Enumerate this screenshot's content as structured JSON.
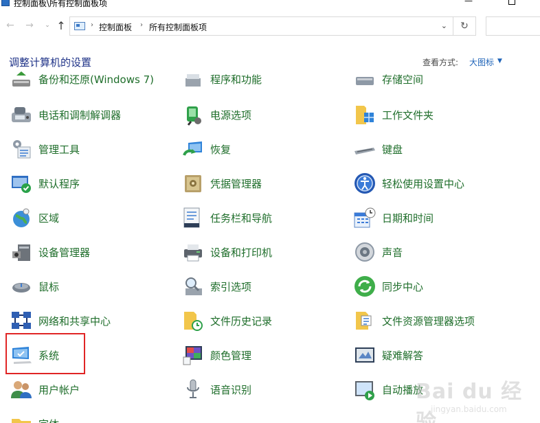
{
  "window": {
    "title": "控制面板\\所有控制面板项",
    "minimize": "—",
    "maximize": ""
  },
  "nav": {
    "back": "←",
    "forward": "→",
    "recent": "⌄",
    "up": "↑",
    "refresh": "↻",
    "breadcrumbs": [
      "控制面板",
      "所有控制面板项"
    ],
    "sep": "›",
    "dropdown": "⌄"
  },
  "header": {
    "title": "调整计算机的设置",
    "view_by_label": "查看方式:",
    "view_by_value": "大图标",
    "view_caret": "▼"
  },
  "items": {
    "col1": [
      {
        "label": "备份和还原(Windows 7)",
        "icon": "backup-icon"
      },
      {
        "label": "电话和调制解调器",
        "icon": "phone-modem-icon"
      },
      {
        "label": "管理工具",
        "icon": "admin-tools-icon"
      },
      {
        "label": "默认程序",
        "icon": "default-programs-icon"
      },
      {
        "label": "区域",
        "icon": "region-globe-icon"
      },
      {
        "label": "设备管理器",
        "icon": "device-manager-icon"
      },
      {
        "label": "鼠标",
        "icon": "mouse-icon"
      },
      {
        "label": "网络和共享中心",
        "icon": "network-icon"
      },
      {
        "label": "系统",
        "icon": "system-monitor-icon"
      },
      {
        "label": "用户帐户",
        "icon": "user-accounts-icon"
      },
      {
        "label": "字体",
        "icon": "fonts-folder-icon"
      }
    ],
    "col2": [
      {
        "label": "程序和功能",
        "icon": "programs-icon"
      },
      {
        "label": "电源选项",
        "icon": "power-options-icon"
      },
      {
        "label": "恢复",
        "icon": "recovery-icon"
      },
      {
        "label": "凭据管理器",
        "icon": "credential-vault-icon"
      },
      {
        "label": "任务栏和导航",
        "icon": "taskbar-icon"
      },
      {
        "label": "设备和打印机",
        "icon": "printer-icon"
      },
      {
        "label": "索引选项",
        "icon": "index-search-icon"
      },
      {
        "label": "文件历史记录",
        "icon": "file-history-icon"
      },
      {
        "label": "颜色管理",
        "icon": "color-management-icon"
      },
      {
        "label": "语音识别",
        "icon": "microphone-icon"
      }
    ],
    "col3": [
      {
        "label": "存储空间",
        "icon": "storage-icon"
      },
      {
        "label": "工作文件夹",
        "icon": "work-folders-icon"
      },
      {
        "label": "键盘",
        "icon": "keyboard-icon"
      },
      {
        "label": "轻松使用设置中心",
        "icon": "ease-of-access-icon"
      },
      {
        "label": "日期和时间",
        "icon": "date-time-icon"
      },
      {
        "label": "声音",
        "icon": "speaker-icon"
      },
      {
        "label": "同步中心",
        "icon": "sync-center-icon"
      },
      {
        "label": "文件资源管理器选项",
        "icon": "folder-options-icon"
      },
      {
        "label": "疑难解答",
        "icon": "troubleshoot-icon"
      },
      {
        "label": "自动播放",
        "icon": "autoplay-icon"
      }
    ]
  },
  "watermark": {
    "text": "Bai du 经验",
    "sub": "jingyan.baidu.com"
  },
  "colors": {
    "link_green": "#1f6e2b",
    "title_blue": "#1e3287",
    "accent_blue": "#1e63b8",
    "highlight_red": "#e02424"
  }
}
